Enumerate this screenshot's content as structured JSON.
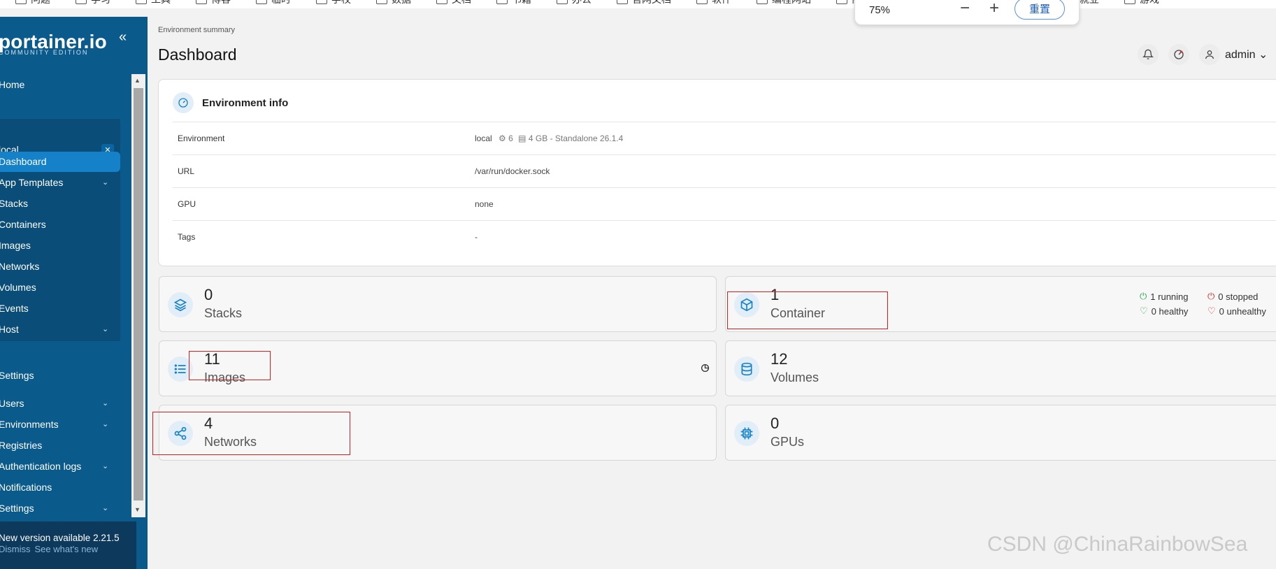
{
  "browser": {
    "bookmarks": [
      "问题",
      "学习",
      "工具",
      "博客",
      "临时",
      "学校",
      "数据",
      "文档",
      "书籍",
      "办公",
      "官网文档",
      "软件",
      "编程网站",
      "商品",
      "就业",
      "游戏"
    ],
    "zoom": {
      "value": "75%",
      "minus": "−",
      "plus": "+",
      "reset_label": "重置"
    }
  },
  "sidebar": {
    "logo": "portainer.io",
    "logo_subtitle": "COMMUNITY EDITION",
    "collapse_icon": "«",
    "home": "Home",
    "environment": {
      "name": "local",
      "close": "✕"
    },
    "env_items": [
      {
        "label": "Dashboard",
        "chevron": ""
      },
      {
        "label": "App Templates",
        "chevron": "⌄"
      },
      {
        "label": "Stacks",
        "chevron": ""
      },
      {
        "label": "Containers",
        "chevron": ""
      },
      {
        "label": "Images",
        "chevron": ""
      },
      {
        "label": "Networks",
        "chevron": ""
      },
      {
        "label": "Volumes",
        "chevron": ""
      },
      {
        "label": "Events",
        "chevron": ""
      },
      {
        "label": "Host",
        "chevron": "⌄"
      }
    ],
    "settings_section": "Settings",
    "settings_items": [
      {
        "label": "Users",
        "chevron": "⌄"
      },
      {
        "label": "Environments",
        "chevron": "⌄"
      },
      {
        "label": "Registries",
        "chevron": ""
      },
      {
        "label": "Authentication logs",
        "chevron": "⌄"
      },
      {
        "label": "Notifications",
        "chevron": ""
      },
      {
        "label": "Settings",
        "chevron": "⌄"
      }
    ],
    "update": {
      "text": "New version available 2.21.5",
      "dismiss": "Dismiss",
      "see_new": "See what's new"
    }
  },
  "header": {
    "breadcrumb": "Environment summary",
    "title": "Dashboard",
    "user": "admin",
    "user_chevron": "⌄"
  },
  "env_info": {
    "title": "Environment info",
    "rows": [
      {
        "key": "Environment",
        "name": "local",
        "cpu": "6",
        "memory": "4 GB",
        "detail": "- Standalone 26.1.4"
      },
      {
        "key": "URL",
        "value": "/var/run/docker.sock"
      },
      {
        "key": "GPU",
        "value": "none"
      },
      {
        "key": "Tags",
        "value": "-"
      }
    ]
  },
  "stats": {
    "stacks": {
      "count": "0",
      "label": "Stacks"
    },
    "containers": {
      "count": "1",
      "label": "Container",
      "running": "1 running",
      "stopped": "0 stopped",
      "healthy": "0 healthy",
      "unhealthy": "0 unhealthy"
    },
    "images": {
      "count": "11",
      "label": "Images"
    },
    "volumes": {
      "count": "12",
      "label": "Volumes"
    },
    "networks": {
      "count": "4",
      "label": "Networks"
    },
    "gpus": {
      "count": "0",
      "label": "GPUs"
    }
  },
  "watermark": "CSDN @ChinaRainbowSea",
  "colors": {
    "sidebar": "#0b5a8c",
    "accent": "#1481c8",
    "annotation": "#d61f1f",
    "running": "#2ea44f",
    "stopped": "#d32f2f"
  }
}
